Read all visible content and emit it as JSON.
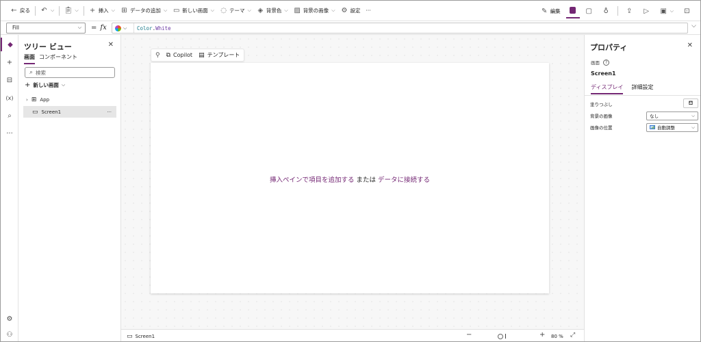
{
  "toolbar": {
    "back": "戻る",
    "insert": "挿入",
    "add_data": "データの追加",
    "new_screen": "新しい画面",
    "theme": "テーマ",
    "background_color": "背景色",
    "background_image": "背景の画像",
    "settings": "設定",
    "more": "···",
    "edit": "編集"
  },
  "formula": {
    "property": "Fill",
    "equals": "=",
    "fx": "fx",
    "code_class": "Color",
    "code_dot": ".",
    "code_member": "White"
  },
  "tree": {
    "title": "ツリー ビュー",
    "tabs": [
      "画面",
      "コンポーネント"
    ],
    "search_placeholder": "検索",
    "new_screen": "新しい画面",
    "nodes": [
      {
        "label": "App"
      },
      {
        "label": "Screen1",
        "more": "···"
      }
    ]
  },
  "canvas": {
    "copilot": "Copilot",
    "template": "テンプレート",
    "hint_link1": "挿入ペインで項目を追加する",
    "hint_middle": " または ",
    "hint_link2": "データに接続する"
  },
  "status": {
    "screen": "Screen1",
    "zoom": "80",
    "zoom_unit": "%"
  },
  "properties": {
    "title": "プロパティ",
    "type": "画面",
    "name": "Screen1",
    "tabs": [
      "ディスプレイ",
      "詳細設定"
    ],
    "rows": [
      {
        "label": "塗りつぶし"
      },
      {
        "label": "背景の画像",
        "value": "なし"
      },
      {
        "label": "画像の位置",
        "value": "自動調整"
      }
    ]
  },
  "colors": {
    "accent": "#742774",
    "code_class": "#1b7a8a"
  }
}
